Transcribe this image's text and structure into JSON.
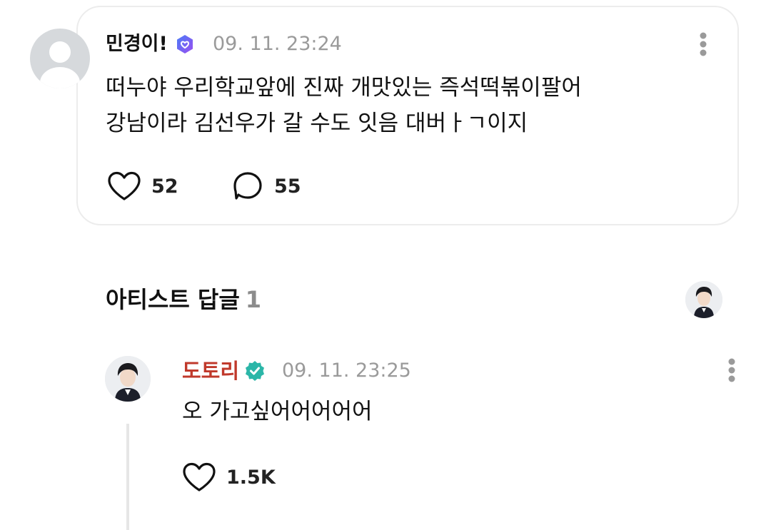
{
  "post": {
    "author": "민경이!",
    "timestamp": "09. 11. 23:24",
    "body_lines": [
      "떠누야 우리학교앞에 진짜 개맛있는 즉석떡볶이팔어",
      "강남이라 김선우가 갈 수도 잇음 대버ㅏㄱ이지"
    ],
    "like_count": "52",
    "comment_count": "55"
  },
  "artist_replies": {
    "title": "아티스트 답글",
    "count": "1"
  },
  "reply": {
    "author": "도토리",
    "timestamp": "09. 11. 23:25",
    "text": "오 가고싶어어어어어",
    "like_count": "1.5K"
  },
  "colors": {
    "artist_name": "#c0392b",
    "verified_teal": "#2bb6a8",
    "verified_purple": "#7a4df2",
    "timestamp": "#9a9a9a"
  },
  "icons": [
    "more-vertical-icon",
    "heart-icon",
    "comment-bubble-icon",
    "verified-badge-icon"
  ]
}
